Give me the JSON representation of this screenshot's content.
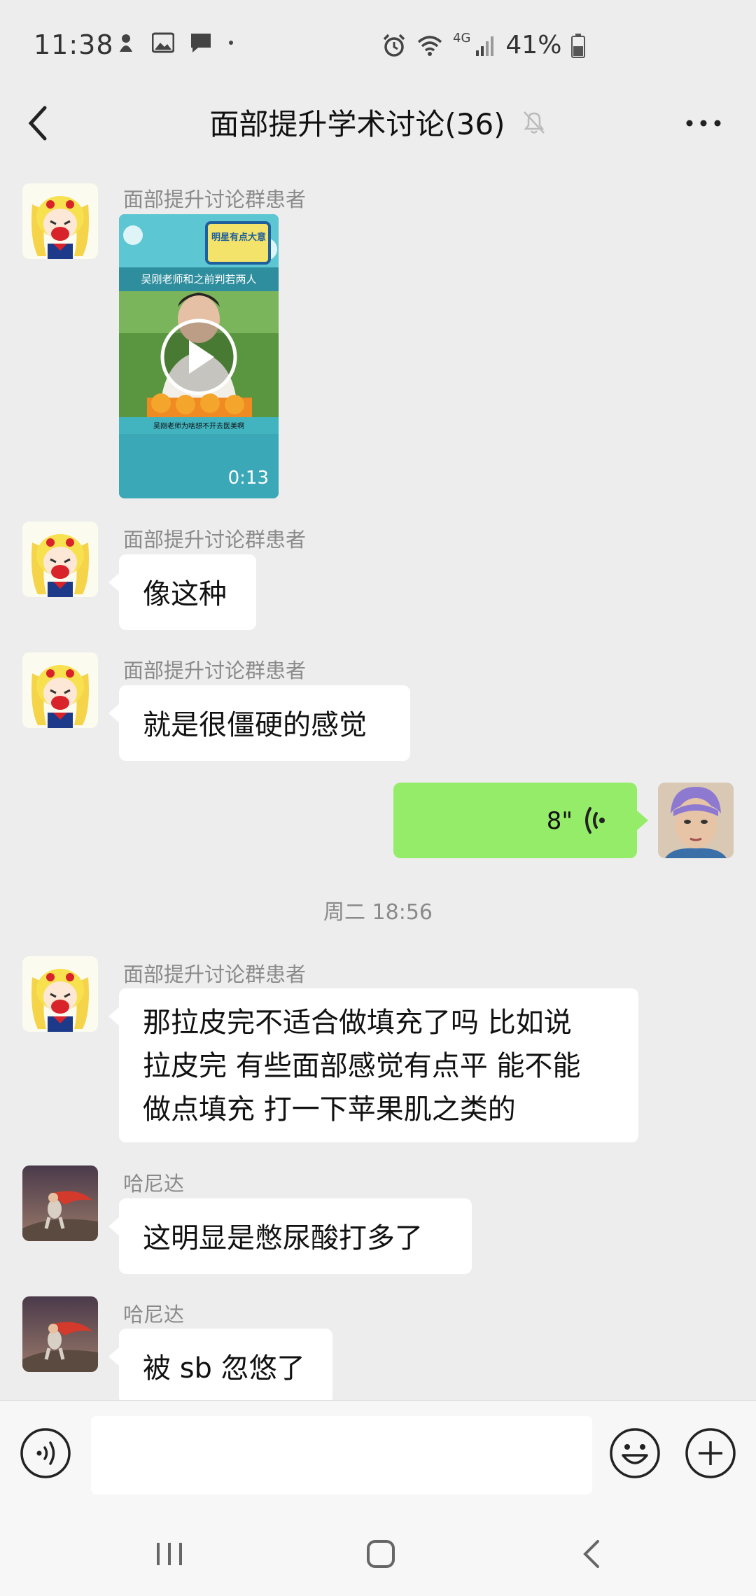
{
  "status_bar": {
    "time": "11:38",
    "battery_pct": "41%",
    "network": "4G"
  },
  "header": {
    "title": "面部提升学术讨论(36)"
  },
  "messages": [
    {
      "sender": "面部提升讨论群患者",
      "type": "video",
      "duration": "0:13",
      "thumb_top_text": "吴刚老师和之前判若两人",
      "thumb_bottom_text": "吴刚老师为啥想不开去医美啊",
      "thumb_badge_text": "明星有点大意"
    },
    {
      "sender": "面部提升讨论群患者",
      "text": "像这种"
    },
    {
      "sender": "面部提升讨论群患者",
      "text": "就是很僵硬的感觉"
    },
    {
      "sender": "me",
      "type": "voice",
      "duration": "8\""
    },
    {
      "timestamp": "周二 18:56"
    },
    {
      "sender": "面部提升讨论群患者",
      "lines": [
        "那拉皮完不适合做填充了吗 比如说",
        "拉皮完 有些面部感觉有点平 能不能",
        "做点填充 打一下苹果肌之类的"
      ]
    },
    {
      "sender": "哈尼达",
      "text": "这明显是憋尿酸打多了"
    },
    {
      "sender": "哈尼达",
      "text": "被 sb 忽悠了"
    }
  ],
  "input": {
    "placeholder": ""
  },
  "icons": {
    "back": "back-arrow-icon",
    "mute": "bell-off-icon",
    "more": "more-dots-icon",
    "voice_toggle": "voice-input-icon",
    "emoji": "emoji-icon",
    "add": "plus-icon",
    "play": "play-icon",
    "voice_wave": "voice-wave-icon"
  },
  "colors": {
    "bubble_me": "#95ec69",
    "bubble_other": "#ffffff",
    "background": "#ededed"
  }
}
